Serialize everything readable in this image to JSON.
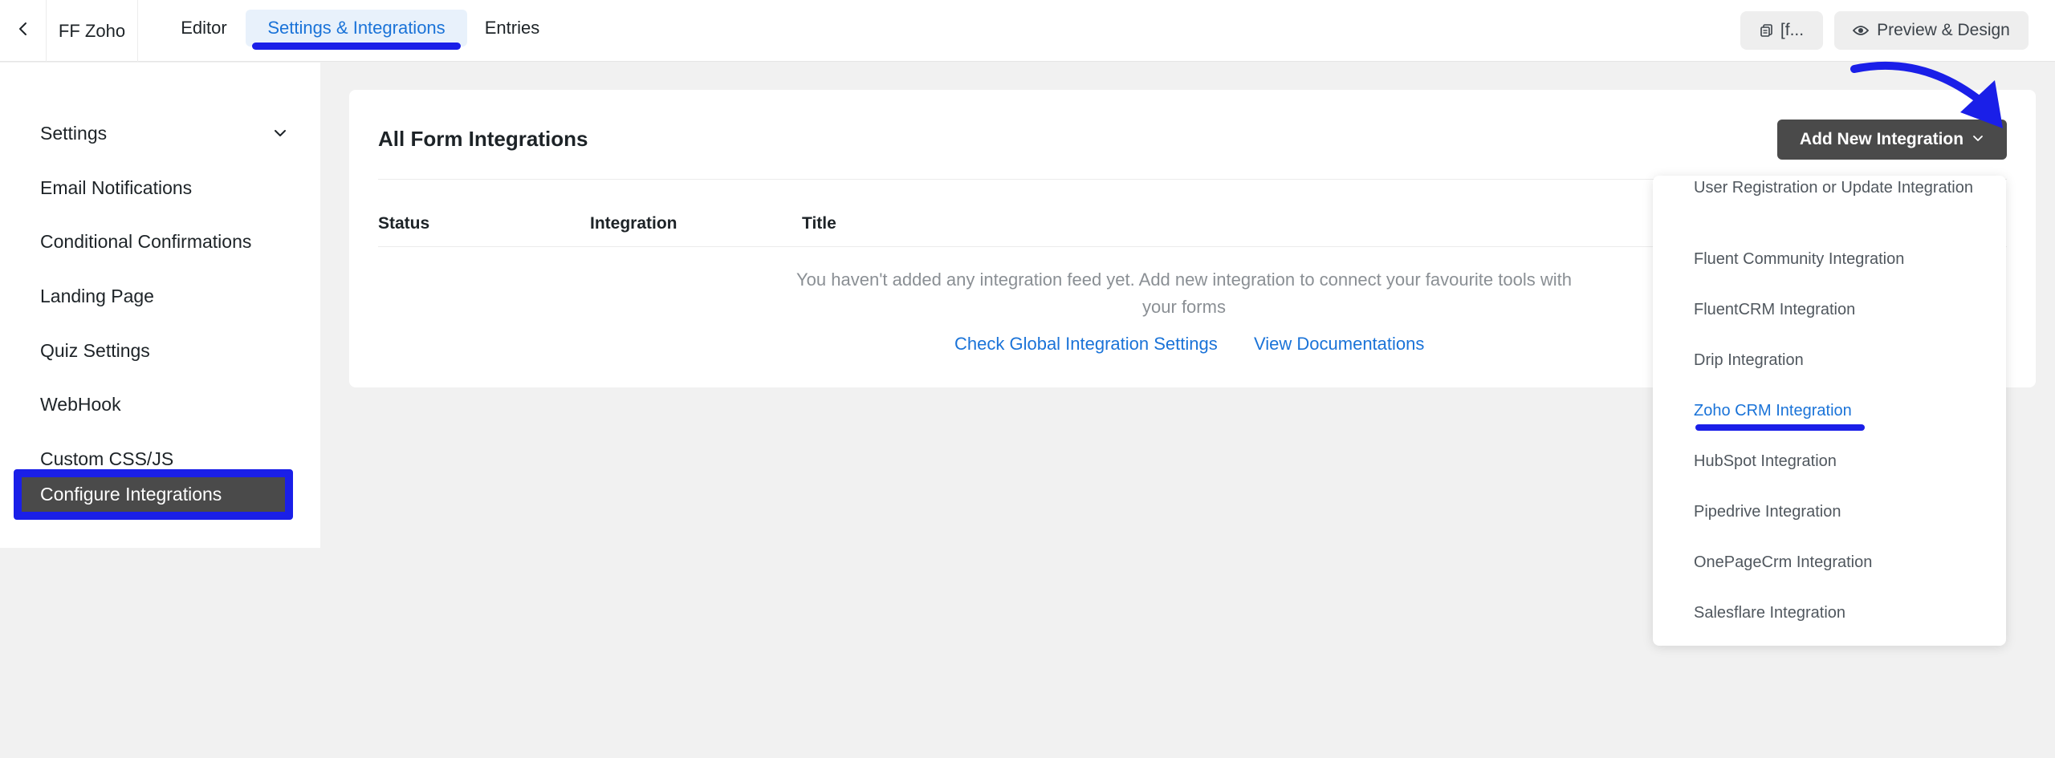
{
  "header": {
    "form_title": "FF Zoho",
    "tabs": [
      {
        "label": "Editor"
      },
      {
        "label": "Settings & Integrations"
      },
      {
        "label": "Entries"
      }
    ],
    "shortcode_label": "[f...",
    "preview_label": "Preview & Design"
  },
  "sidebar": {
    "items": [
      {
        "label": "Settings"
      },
      {
        "label": "Email Notifications"
      },
      {
        "label": "Conditional Confirmations"
      },
      {
        "label": "Landing Page"
      },
      {
        "label": "Quiz Settings"
      },
      {
        "label": "WebHook"
      },
      {
        "label": "Custom CSS/JS"
      },
      {
        "label": "Configure Integrations"
      }
    ]
  },
  "main": {
    "title": "All Form Integrations",
    "add_button_label": "Add New Integration",
    "columns": [
      "Status",
      "Integration",
      "Title"
    ],
    "empty_message": "You haven't added any integration feed yet. Add new integration to connect your favourite tools with your forms",
    "links": {
      "global_settings": "Check Global Integration Settings",
      "documentation": "View Documentations"
    }
  },
  "dropdown": {
    "items": [
      {
        "label": "User Registration or Update Integration"
      },
      {
        "label": "Fluent Community Integration"
      },
      {
        "label": "FluentCRM Integration"
      },
      {
        "label": "Drip Integration"
      },
      {
        "label": "Zoho CRM Integration"
      },
      {
        "label": "HubSpot Integration"
      },
      {
        "label": "Pipedrive Integration"
      },
      {
        "label": "OnePageCrm Integration"
      },
      {
        "label": "Salesflare Integration"
      }
    ]
  },
  "colors": {
    "accent": "#1a73d8",
    "annotation": "#1a1fe8",
    "dark_button": "#4a4a4a"
  }
}
